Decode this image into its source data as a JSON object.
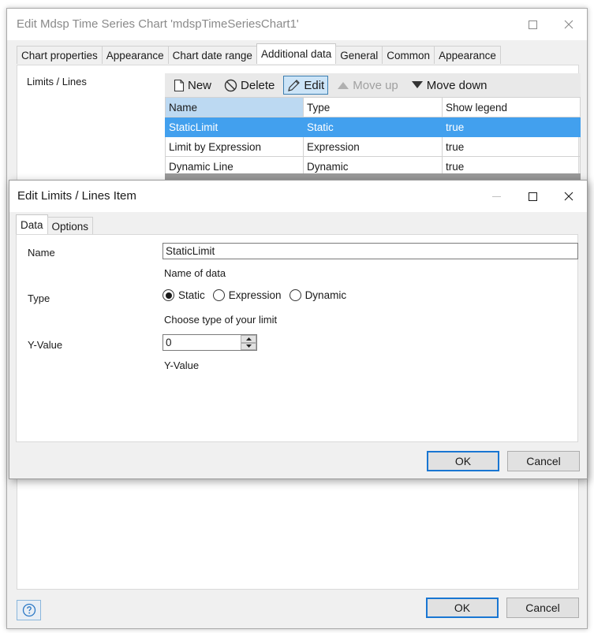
{
  "outer": {
    "title": "Edit Mdsp Time Series Chart 'mdspTimeSeriesChart1'",
    "tabs": [
      "Chart properties",
      "Appearance",
      "Chart date range",
      "Additional data",
      "General",
      "Common",
      "Appearance"
    ],
    "active_tab_index": 3,
    "section_label": "Limits / Lines",
    "toolbar": {
      "new_label": "New",
      "delete_label": "Delete",
      "edit_label": "Edit",
      "move_up_label": "Move up",
      "move_down_label": "Move down"
    },
    "columns": [
      "Name",
      "Type",
      "Show legend"
    ],
    "rows": [
      {
        "name": "StaticLimit",
        "type": "Static",
        "show_legend": "true"
      },
      {
        "name": "Limit by Expression",
        "type": "Expression",
        "show_legend": "true"
      },
      {
        "name": "Dynamic Line",
        "type": "Dynamic",
        "show_legend": "true"
      }
    ],
    "ok_label": "OK",
    "cancel_label": "Cancel"
  },
  "inner": {
    "title": "Edit Limits / Lines Item",
    "tabs": [
      "Data",
      "Options"
    ],
    "fields": {
      "name_label": "Name",
      "name_value": "StaticLimit",
      "name_hint": "Name of data",
      "type_label": "Type",
      "type_options": [
        "Static",
        "Expression",
        "Dynamic"
      ],
      "type_selected": "Static",
      "type_hint": "Choose type of your limit",
      "yvalue_label": "Y-Value",
      "yvalue_value": "0",
      "yvalue_hint": "Y-Value"
    },
    "ok_label": "OK",
    "cancel_label": "Cancel"
  },
  "colors": {
    "selection": "#42a0ee",
    "header_sorted": "#bcd9f2",
    "default_button_border": "#1976d2"
  }
}
